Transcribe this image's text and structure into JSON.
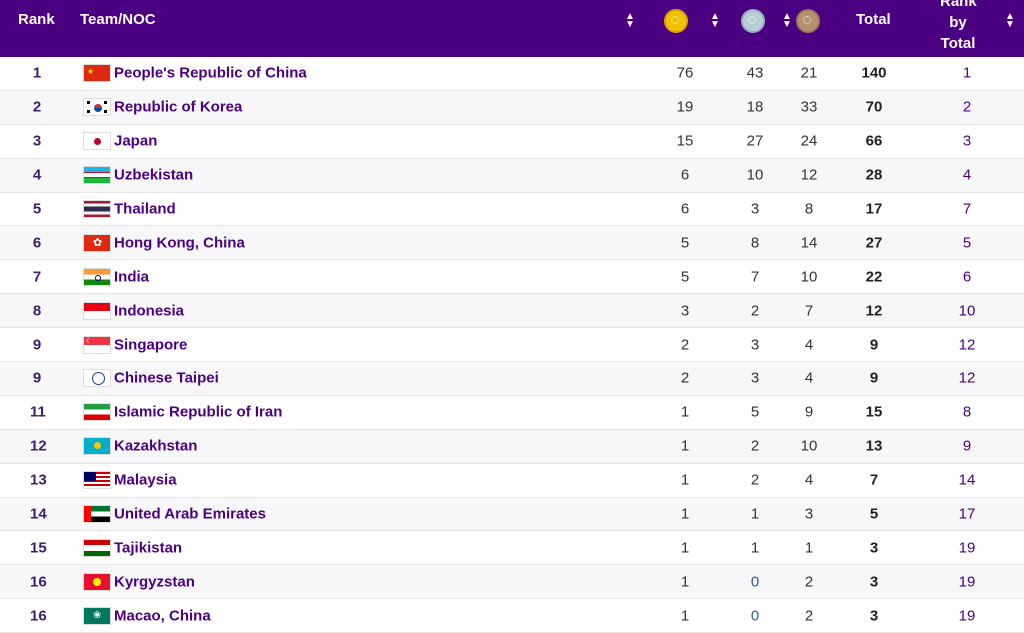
{
  "header": {
    "rank": "Rank",
    "team": "Team/NOC",
    "total": "Total",
    "rank_by_total_1": "Rank",
    "rank_by_total_2": "by",
    "rank_by_total_3": "Total",
    "sort_up": "▲",
    "sort_down": "▼"
  },
  "rows": [
    {
      "rank": "1",
      "team": "People's Republic of China",
      "gold": "76",
      "silver": "43",
      "bronze": "21",
      "total": "140",
      "rbt": "1",
      "flag": "china"
    },
    {
      "rank": "2",
      "team": "Republic of Korea",
      "gold": "19",
      "silver": "18",
      "bronze": "33",
      "total": "70",
      "rbt": "2",
      "flag": "korea"
    },
    {
      "rank": "3",
      "team": "Japan",
      "gold": "15",
      "silver": "27",
      "bronze": "24",
      "total": "66",
      "rbt": "3",
      "flag": "japan"
    },
    {
      "rank": "4",
      "team": "Uzbekistan",
      "gold": "6",
      "silver": "10",
      "bronze": "12",
      "total": "28",
      "rbt": "4",
      "flag": "uzbekistan"
    },
    {
      "rank": "5",
      "team": "Thailand",
      "gold": "6",
      "silver": "3",
      "bronze": "8",
      "total": "17",
      "rbt": "7",
      "flag": "thailand"
    },
    {
      "rank": "6",
      "team": "Hong Kong, China",
      "gold": "5",
      "silver": "8",
      "bronze": "14",
      "total": "27",
      "rbt": "5",
      "flag": "hongkong"
    },
    {
      "rank": "7",
      "team": "India",
      "gold": "5",
      "silver": "7",
      "bronze": "10",
      "total": "22",
      "rbt": "6",
      "flag": "india"
    },
    {
      "rank": "8",
      "team": "Indonesia",
      "gold": "3",
      "silver": "2",
      "bronze": "7",
      "total": "12",
      "rbt": "10",
      "flag": "indonesia"
    },
    {
      "rank": "9",
      "team": "Singapore",
      "gold": "2",
      "silver": "3",
      "bronze": "4",
      "total": "9",
      "rbt": "12",
      "flag": "singapore"
    },
    {
      "rank": "9",
      "team": "Chinese Taipei",
      "gold": "2",
      "silver": "3",
      "bronze": "4",
      "total": "9",
      "rbt": "12",
      "flag": "taipei"
    },
    {
      "rank": "11",
      "team": "Islamic Republic of Iran",
      "gold": "1",
      "silver": "5",
      "bronze": "9",
      "total": "15",
      "rbt": "8",
      "flag": "iran"
    },
    {
      "rank": "12",
      "team": "Kazakhstan",
      "gold": "1",
      "silver": "2",
      "bronze": "10",
      "total": "13",
      "rbt": "9",
      "flag": "kazakhstan"
    },
    {
      "rank": "13",
      "team": "Malaysia",
      "gold": "1",
      "silver": "2",
      "bronze": "4",
      "total": "7",
      "rbt": "14",
      "flag": "malaysia"
    },
    {
      "rank": "14",
      "team": "United Arab Emirates",
      "gold": "1",
      "silver": "1",
      "bronze": "3",
      "total": "5",
      "rbt": "17",
      "flag": "uae"
    },
    {
      "rank": "15",
      "team": "Tajikistan",
      "gold": "1",
      "silver": "1",
      "bronze": "1",
      "total": "3",
      "rbt": "19",
      "flag": "tajikistan"
    },
    {
      "rank": "16",
      "team": "Kyrgyzstan",
      "gold": "1",
      "silver": "0",
      "bronze": "2",
      "total": "3",
      "rbt": "19",
      "flag": "kyrgyzstan"
    },
    {
      "rank": "16",
      "team": "Macao, China",
      "gold": "1",
      "silver": "0",
      "bronze": "2",
      "total": "3",
      "rbt": "19",
      "flag": "macao"
    }
  ],
  "colors": {
    "header_bg": "#4b0082",
    "team_text": "#4b0082"
  }
}
